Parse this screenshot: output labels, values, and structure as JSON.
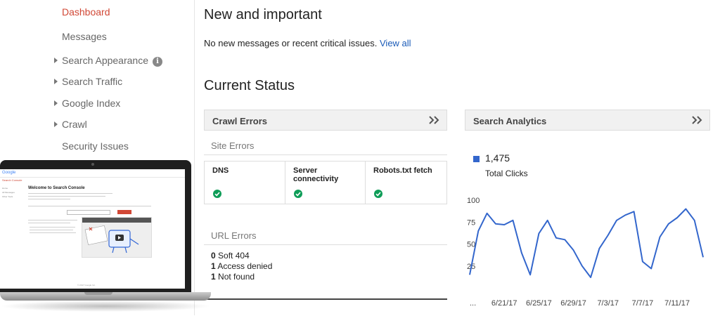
{
  "sidebar": {
    "items": [
      {
        "label": "Dashboard",
        "active": true,
        "expandable": false,
        "info": false
      },
      {
        "label": "Messages",
        "active": false,
        "expandable": false,
        "info": false
      },
      {
        "label": "Search Appearance",
        "active": false,
        "expandable": true,
        "info": true
      },
      {
        "label": "Search Traffic",
        "active": false,
        "expandable": true,
        "info": false
      },
      {
        "label": "Google Index",
        "active": false,
        "expandable": true,
        "info": false
      },
      {
        "label": "Crawl",
        "active": false,
        "expandable": true,
        "info": false
      },
      {
        "label": "Security Issues",
        "active": false,
        "expandable": false,
        "info": false
      }
    ],
    "info_glyph": "i"
  },
  "main": {
    "new_important": {
      "title": "New and important",
      "message": "No new messages or recent critical issues.",
      "view_all": "View all"
    },
    "current_status": {
      "title": "Current Status"
    },
    "crawl_errors": {
      "title": "Crawl Errors",
      "site_errors_label": "Site Errors",
      "columns": [
        {
          "label": "DNS",
          "status": "ok"
        },
        {
          "label": "Server connectivity",
          "status": "ok"
        },
        {
          "label": "Robots.txt fetch",
          "status": "ok"
        }
      ],
      "url_errors_label": "URL Errors",
      "url_errors": [
        {
          "count": "0",
          "label": "Soft 404"
        },
        {
          "count": "1",
          "label": "Access denied"
        },
        {
          "count": "1",
          "label": "Not found"
        }
      ]
    },
    "search_analytics": {
      "title": "Search Analytics",
      "metric_value": "1,475",
      "metric_label": "Total Clicks"
    }
  },
  "laptop_screen": {
    "logo": "Google",
    "app_name": "Search Console",
    "side_items": [
      "Home",
      "All Messages",
      "Other Tools"
    ],
    "title": "Welcome to Search Console",
    "video_label": "Google Search Console"
  },
  "icons": {
    "nav_caret": "caret-right-icon",
    "info": "info-icon",
    "expand": "double-chevron-right-icon",
    "ok": "check-circle-icon"
  },
  "colors": {
    "active_nav": "#d14836",
    "link": "#1a5bb8",
    "series": "#3366cc",
    "ok": "#0f9d58"
  },
  "chart_data": {
    "type": "line",
    "x": [
      "...",
      "6/18/17",
      "6/19/17",
      "6/20/17",
      "6/21/17",
      "6/22/17",
      "6/23/17",
      "6/24/17",
      "6/25/17",
      "6/26/17",
      "6/27/17",
      "6/28/17",
      "6/29/17",
      "6/30/17",
      "7/1/17",
      "7/2/17",
      "7/3/17",
      "7/4/17",
      "7/5/17",
      "7/6/17",
      "7/7/17",
      "7/8/17",
      "7/9/17",
      "7/10/17",
      "7/11/17",
      "7/12/17",
      "7/13/17",
      "7/14/17"
    ],
    "x_tick_labels": [
      "...",
      "6/21/17",
      "6/25/17",
      "6/29/17",
      "7/3/17",
      "7/7/17",
      "7/11/17"
    ],
    "x_tick_index": [
      0,
      4,
      8,
      12,
      16,
      20,
      24
    ],
    "series": [
      {
        "values": [
          15,
          65,
          85,
          73,
          72,
          77,
          40,
          15,
          62,
          77,
          57,
          55,
          43,
          25,
          12,
          45,
          60,
          77,
          83,
          87,
          30,
          22,
          58,
          73,
          80,
          90,
          77,
          35
        ]
      }
    ],
    "ylim": [
      0,
      100
    ],
    "y_ticks": [
      25,
      50,
      75,
      100
    ],
    "grid": false
  }
}
